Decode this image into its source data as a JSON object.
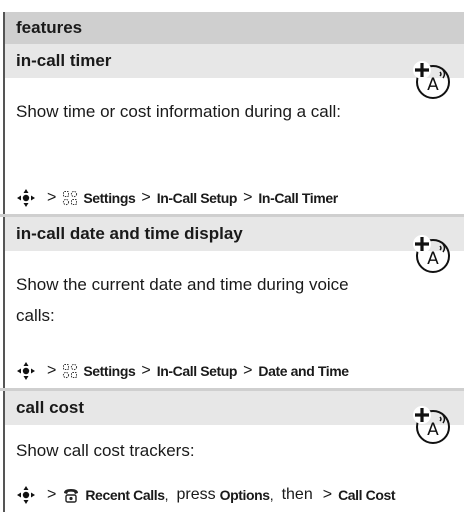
{
  "header": {
    "title": "features"
  },
  "sections": [
    {
      "title": "in-call timer",
      "description": "Show time or cost information during a call:",
      "path": {
        "settings": "Settings",
        "setup": "In-Call Setup",
        "item": "In-Call Timer"
      }
    },
    {
      "title": "in-call date and time display",
      "description": "Show the current date and time during voice calls:",
      "path": {
        "settings": "Settings",
        "setup": "In-Call Setup",
        "item": "Date and Time"
      }
    },
    {
      "title": "call cost",
      "description": "Show call cost trackers:",
      "path": {
        "recent": "Recent Calls",
        "press": "press",
        "options": "Options",
        "then": "then",
        "item": "Call Cost"
      }
    }
  ],
  "icons": {
    "nav_key": "nav-key-icon",
    "settings": "settings-icon",
    "recent_calls": "recent-calls-icon",
    "network_feature": "network-feature-icon"
  }
}
